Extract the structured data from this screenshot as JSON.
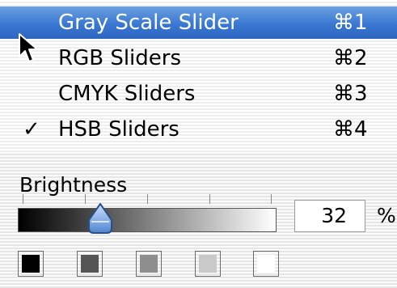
{
  "menu": {
    "items": [
      {
        "label": "Gray Scale Slider",
        "shortcut": "⌘1",
        "checked": false,
        "selected": true
      },
      {
        "label": "RGB Sliders",
        "shortcut": "⌘2",
        "checked": false,
        "selected": false
      },
      {
        "label": "CMYK Sliders",
        "shortcut": "⌘3",
        "checked": false,
        "selected": false
      },
      {
        "label": "HSB Sliders",
        "shortcut": "⌘4",
        "checked": true,
        "selected": false
      }
    ],
    "check_glyph": "✓"
  },
  "slider": {
    "label": "Brightness",
    "value": "32",
    "unit": "%",
    "level": 0.32,
    "gradient_start": "#000000",
    "gradient_end": "#ffffff"
  },
  "swatches": [
    {
      "name": "black",
      "color": "#000000"
    },
    {
      "name": "dark-gray",
      "color": "#555555"
    },
    {
      "name": "medium-gray",
      "color": "#8e8e8e"
    },
    {
      "name": "light-gray",
      "color": "#c9c9c9"
    },
    {
      "name": "white",
      "color": "#ffffff"
    }
  ],
  "colors": {
    "selection": "#3a78d2",
    "thumb": "#8fb4e8"
  }
}
